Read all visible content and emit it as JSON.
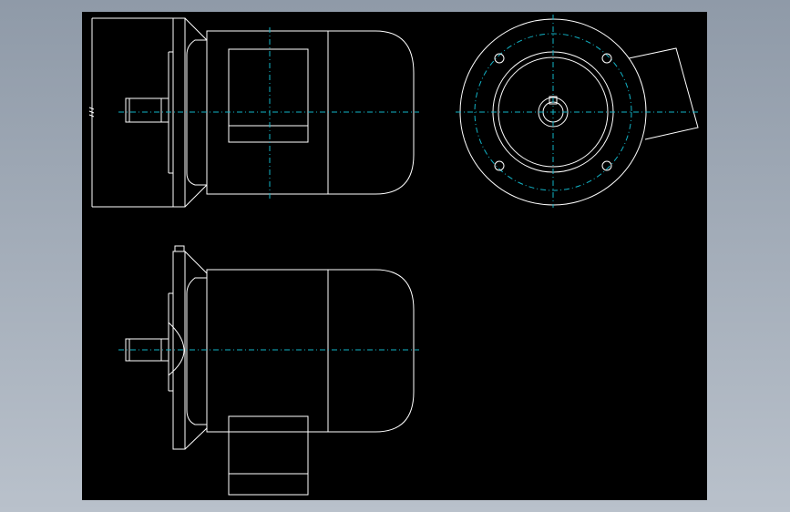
{
  "colors": {
    "background": "#000000",
    "geometry": "#ffffff",
    "centerline": "#12b3c6",
    "window": "#a3adb8"
  },
  "views": [
    {
      "name": "side-view-with-terminal-box-top"
    },
    {
      "name": "front-flange-view"
    },
    {
      "name": "side-view-with-terminal-box-bottom"
    }
  ]
}
